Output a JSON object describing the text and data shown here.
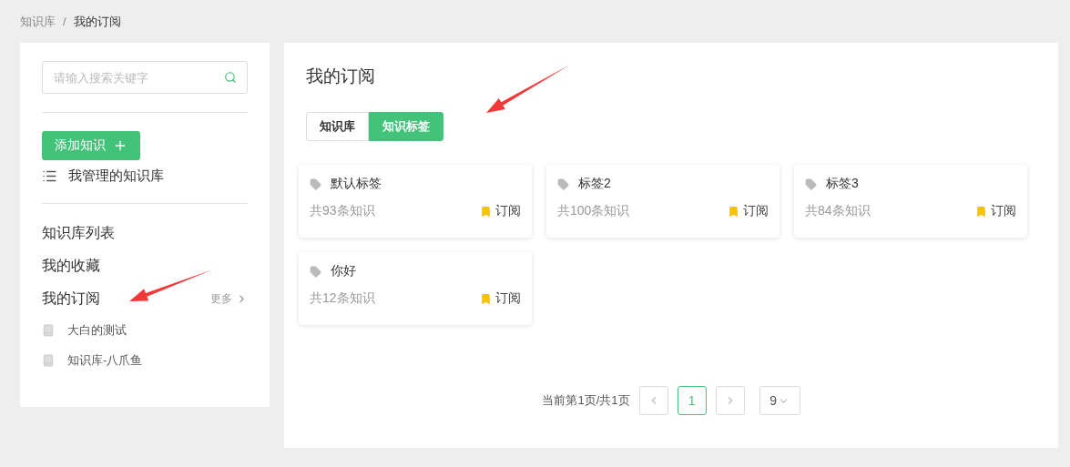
{
  "breadcrumb": [
    {
      "label": "知识库",
      "current": false
    },
    {
      "label": "我的订阅",
      "current": true
    }
  ],
  "breadcrumb_separator": "/",
  "sidebar": {
    "search": {
      "placeholder": "请输入搜索关键字"
    },
    "add_button": "添加知识",
    "managed_link": "我管理的知识库",
    "nav": [
      {
        "label": "知识库列表"
      },
      {
        "label": "我的收藏"
      },
      {
        "label": "我的订阅",
        "more": "更多"
      }
    ],
    "subscriptions": [
      {
        "label": "大白的测试"
      },
      {
        "label": "知识库-八爪鱼"
      }
    ]
  },
  "main": {
    "title": "我的订阅",
    "tabs": [
      {
        "label": "知识库",
        "selected": false
      },
      {
        "label": "知识标签",
        "selected": true
      }
    ],
    "cards": [
      {
        "name": "默认标签",
        "count": "共93条知识",
        "action": "订阅"
      },
      {
        "name": "标签2",
        "count": "共100条知识",
        "action": "订阅"
      },
      {
        "name": "标签3",
        "count": "共84条知识",
        "action": "订阅"
      },
      {
        "name": "你好",
        "count": "共12条知识",
        "action": "订阅"
      }
    ],
    "pagination": {
      "summary": "当前第1页/共1页",
      "pages": [
        {
          "label": "1",
          "selected": true
        }
      ],
      "page_size": "9"
    }
  },
  "annotations": [
    {
      "kind": "arrow"
    },
    {
      "kind": "arrow"
    }
  ]
}
